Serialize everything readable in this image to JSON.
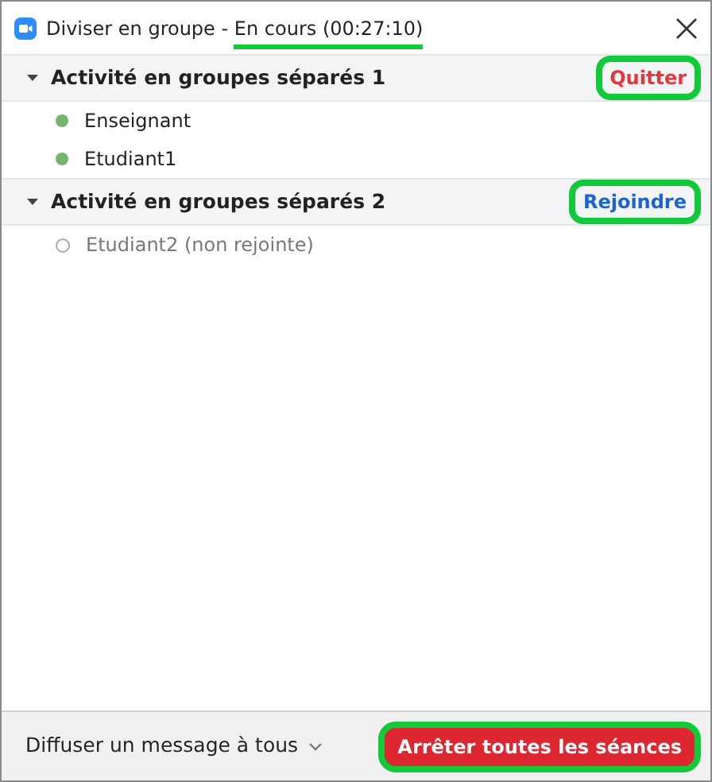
{
  "window": {
    "title": "Diviser en groupe - ",
    "status": "En cours (00:27:10)"
  },
  "groups": [
    {
      "name": "Activité en groupes séparés 1",
      "expanded": true,
      "action": {
        "kind": "leave",
        "label": "Quitter"
      },
      "participants": [
        {
          "name": "Enseignant",
          "joined": true
        },
        {
          "name": "Etudiant1",
          "joined": true
        }
      ]
    },
    {
      "name": "Activité en groupes séparés 2",
      "expanded": true,
      "action": {
        "kind": "join",
        "label": "Rejoindre"
      },
      "participants": [
        {
          "name": "Etudiant2 (non rejointe)",
          "joined": false
        }
      ]
    }
  ],
  "footer": {
    "broadcast": "Diffuser un message à tous",
    "stop_button": "Arrêter toutes les séances"
  }
}
